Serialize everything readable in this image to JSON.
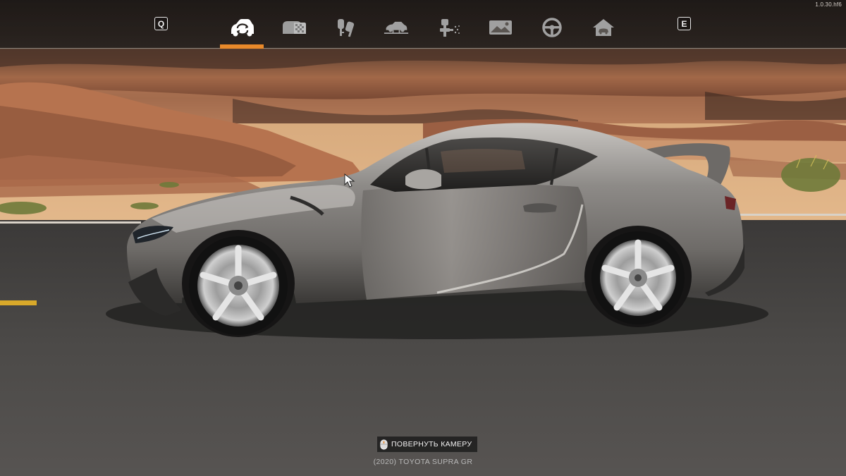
{
  "version": "1.0.30.hf6",
  "nav": {
    "prev_key": "Q",
    "next_key": "E",
    "tabs": [
      {
        "icon": "rotate-car-icon",
        "active": true
      },
      {
        "icon": "garage-cars-icon",
        "active": false
      },
      {
        "icon": "keys-icon",
        "active": false
      },
      {
        "icon": "car-lift-icon",
        "active": false
      },
      {
        "icon": "paint-spray-icon",
        "active": false
      },
      {
        "icon": "car-photo-icon",
        "active": false
      },
      {
        "icon": "steering-wheel-icon",
        "active": false
      },
      {
        "icon": "home-icon",
        "active": false
      }
    ]
  },
  "hint": {
    "icon": "mouse-icon",
    "text": "ПОВЕРНУТЬ КАМЕРУ"
  },
  "car_name": "(2020) TOYOTA SUPRA GR",
  "colors": {
    "accent": "#e8892a",
    "car_paint": "#8a8885"
  }
}
